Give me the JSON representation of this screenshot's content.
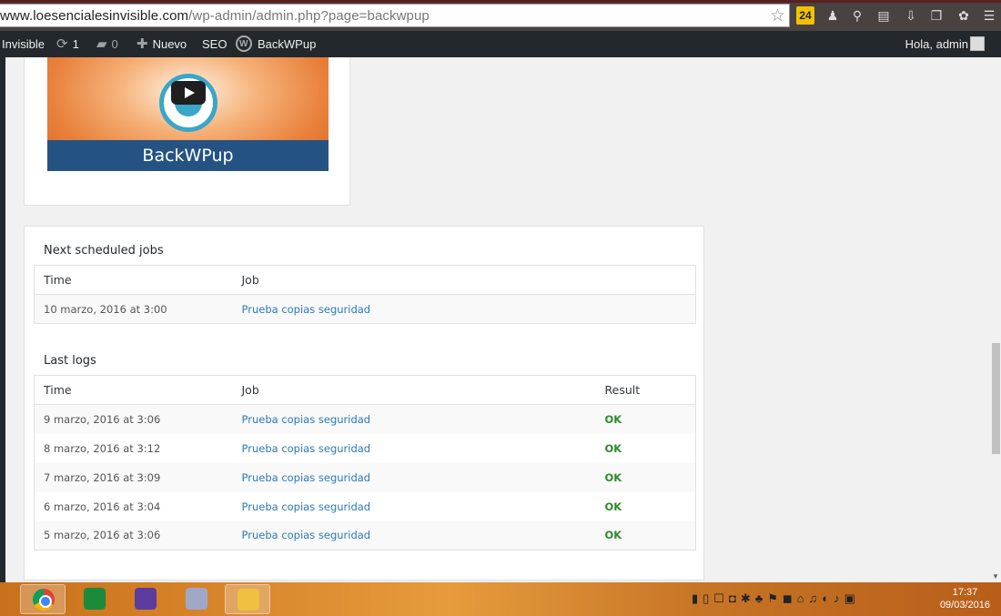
{
  "browser": {
    "url_host": "www.loesencialesinvisible.com",
    "url_path": "/wp-admin/admin.php?page=backwpup",
    "extension_badge": "24"
  },
  "admin_bar": {
    "site_name": "Invisible",
    "updates_count": "1",
    "comments_count": "0",
    "new_label": "Nuevo",
    "seo_label": "SEO",
    "backwpup_label": "BackWPup",
    "greeting": "Hola, admin"
  },
  "video": {
    "title": "BackWPup"
  },
  "next_jobs": {
    "title": "Next scheduled jobs",
    "columns": [
      "Time",
      "Job"
    ],
    "rows": [
      {
        "time": "10 marzo, 2016 at 3:00",
        "job": "Prueba copias seguridad"
      }
    ]
  },
  "last_logs": {
    "title": "Last logs",
    "columns": [
      "Time",
      "Job",
      "Result"
    ],
    "rows": [
      {
        "time": "9 marzo, 2016 at 3:06",
        "job": "Prueba copias seguridad",
        "result": "OK"
      },
      {
        "time": "8 marzo, 2016 at 3:12",
        "job": "Prueba copias seguridad",
        "result": "OK"
      },
      {
        "time": "7 marzo, 2016 at 3:09",
        "job": "Prueba copias seguridad",
        "result": "OK"
      },
      {
        "time": "6 marzo, 2016 at 3:04",
        "job": "Prueba copias seguridad",
        "result": "OK"
      },
      {
        "time": "5 marzo, 2016 at 3:06",
        "job": "Prueba copias seguridad",
        "result": "OK"
      }
    ]
  },
  "taskbar": {
    "time": "17:37",
    "date": "09/03/2016",
    "icons": [
      "chrome-icon",
      "store-icon",
      "calendar-icon",
      "paint-icon",
      "explorer-icon"
    ]
  },
  "colors": {
    "admin_bar_bg": "#23282d",
    "link": "#2b7bb9",
    "ok": "#2e8b2e",
    "video_band": "#245383"
  }
}
